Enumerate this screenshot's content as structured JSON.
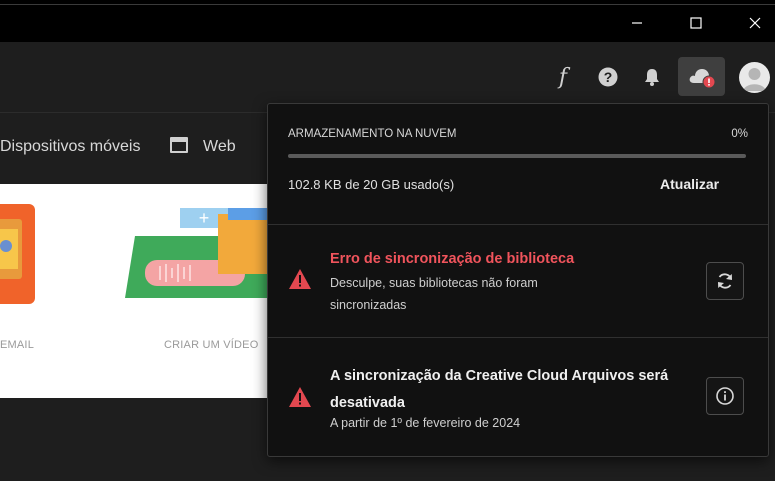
{
  "window": {
    "minimize_icon": "minimize-icon",
    "maximize_icon": "maximize-icon",
    "close_icon": "close-icon"
  },
  "toolbar": {
    "fonts_glyph": "f",
    "help_icon": "help-icon",
    "bell_icon": "bell-icon",
    "cloud_icon": "cloud-error-icon",
    "avatar_icon": "avatar-icon"
  },
  "nav": {
    "mobile_label": "Dispositivos móveis",
    "web_label": "Web"
  },
  "content": {
    "card1_label": "EMAIL",
    "card2_label": "CRIAR UM VÍDEO"
  },
  "cloud_panel": {
    "storage_title": "ARMAZENAMENTO NA NUVEM",
    "storage_percent": "0%",
    "storage_fraction": 0.0,
    "usage_text": "102.8 KB de 20 GB usado(s)",
    "refresh_label": "Atualizar",
    "messages": [
      {
        "title": "Erro de sincronização de biblioteca",
        "body": "Desculpe, suas bibliotecas não foram sincronizadas",
        "title_color": "#f0545c",
        "icon": "warning-icon",
        "action_icon": "sync-icon"
      },
      {
        "title": "A sincronização da Creative Cloud Arquivos será desativada",
        "body": "A partir de 1º de fevereiro de 2024",
        "title_color": "#f0f0f0",
        "icon": "warning-icon",
        "action_icon": "info-icon"
      }
    ]
  },
  "colors": {
    "accent": "#1473e6",
    "error_red": "#e34850",
    "warning_red": "#e34850"
  }
}
